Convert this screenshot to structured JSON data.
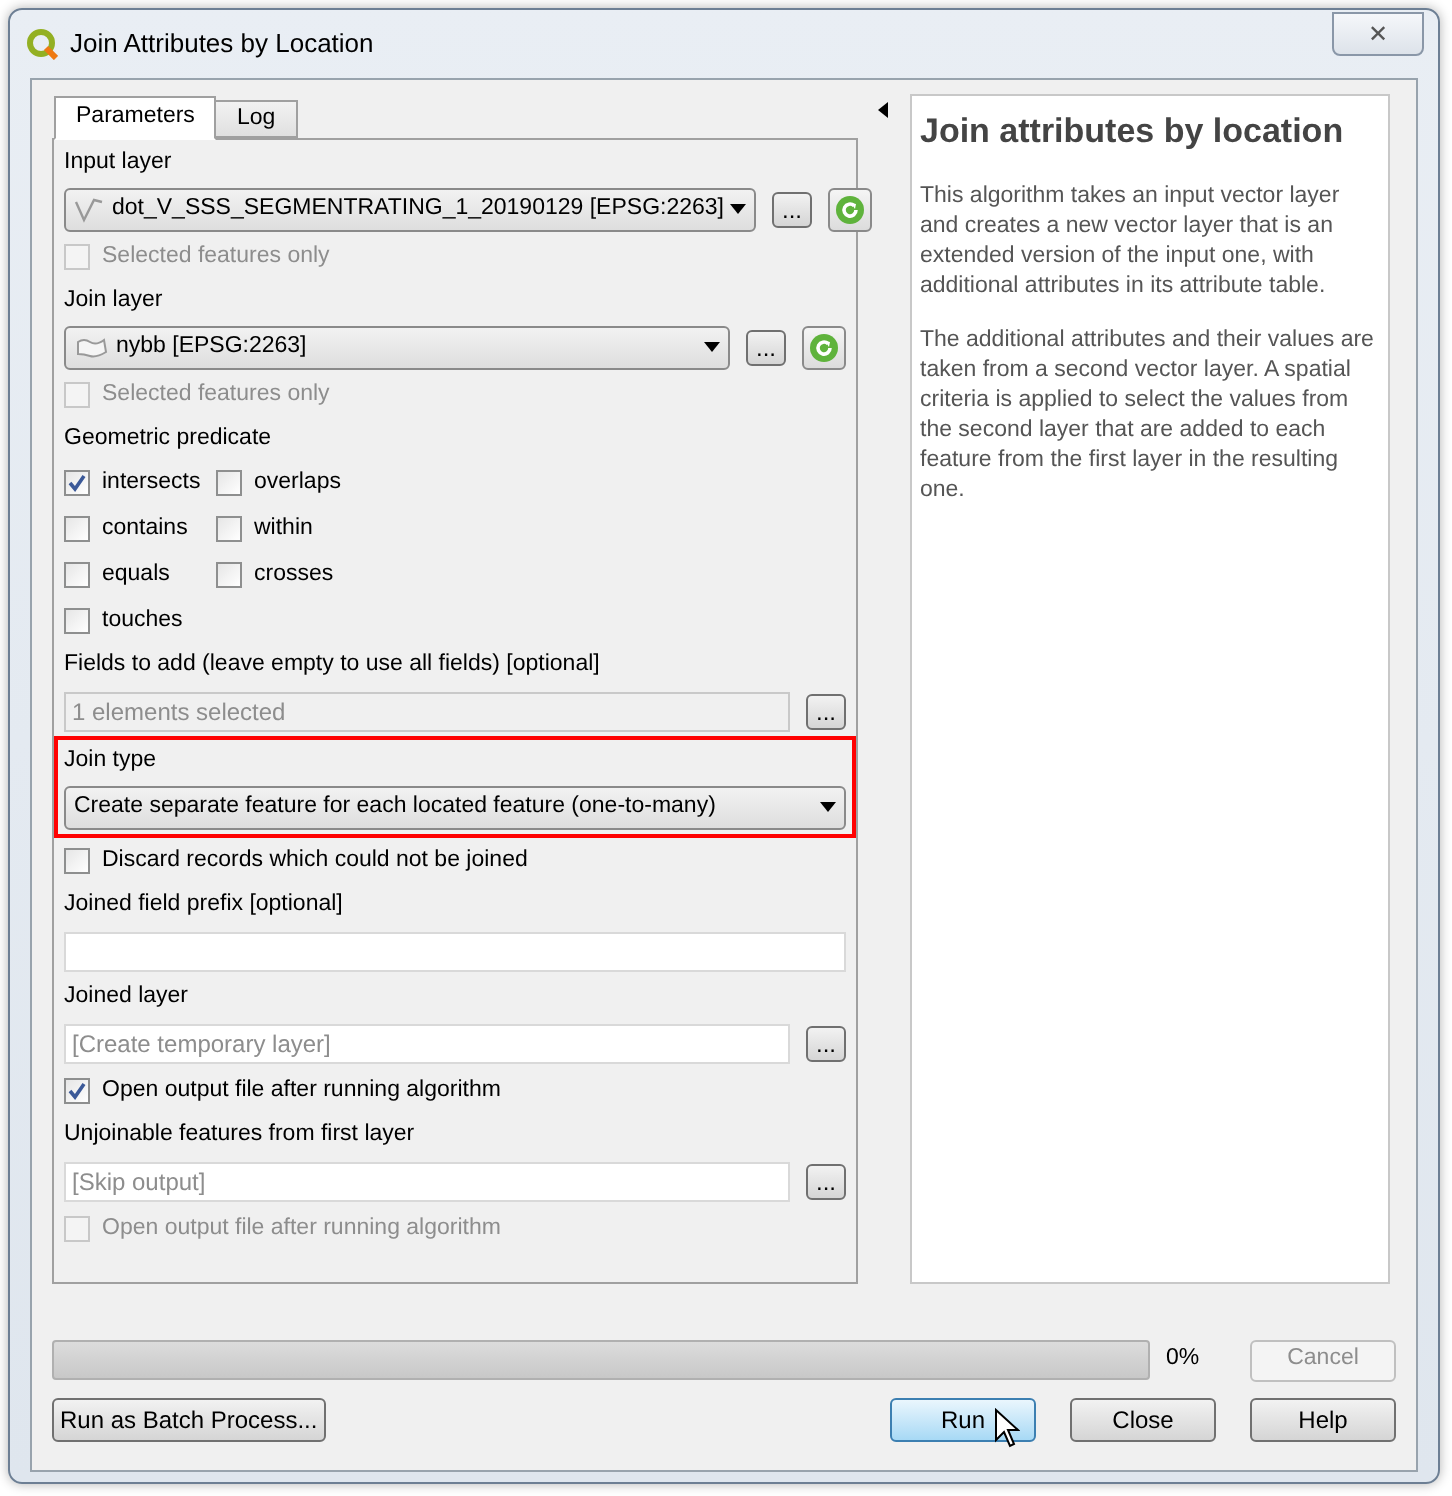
{
  "window": {
    "title": "Join Attributes by Location",
    "close_label": "✕"
  },
  "tabs": [
    {
      "label": "Parameters",
      "selected": true
    },
    {
      "label": "Log",
      "selected": false
    }
  ],
  "params": [
    {
      "kind": "label",
      "text": "Input layer"
    },
    {
      "kind": "line_layer_combo",
      "value": "dot_V_SSS_SEGMENTRATING_1_20190129 [EPSG:2263]",
      "browse_label": "..."
    },
    {
      "kind": "checkbox",
      "label": "Selected features only",
      "checked": false,
      "disabled": true
    },
    {
      "kind": "label",
      "text": "Join layer"
    },
    {
      "kind": "polygon_layer_combo",
      "value": "nybb [EPSG:2263]",
      "browse_label": "..."
    },
    {
      "kind": "checkbox",
      "label": "Selected features only",
      "checked": false,
      "disabled": true
    },
    {
      "kind": "label",
      "text": "Geometric predicate"
    },
    {
      "kind": "checkbox_grid",
      "items": [
        {
          "label": "intersects",
          "checked": true
        },
        {
          "label": "overlaps",
          "checked": false
        },
        {
          "label": "contains",
          "checked": false
        },
        {
          "label": "within",
          "checked": false
        },
        {
          "label": "equals",
          "checked": false
        },
        {
          "label": "crosses",
          "checked": false
        },
        {
          "label": "touches",
          "checked": false
        }
      ]
    },
    {
      "kind": "label",
      "text": "Fields to add (leave empty to use all fields) [optional]"
    },
    {
      "kind": "field",
      "value": "1 elements selected",
      "disabled": true,
      "browse_label": "..."
    },
    {
      "kind": "group",
      "highlighted": true,
      "children": [
        {
          "kind": "label",
          "text": "Join type"
        },
        {
          "kind": "combo",
          "value": "Create separate feature for each located feature (one-to-many)"
        }
      ]
    },
    {
      "kind": "checkbox",
      "label": "Discard records which could not be joined",
      "checked": false,
      "disabled": false
    },
    {
      "kind": "label",
      "text": "Joined field prefix [optional]"
    },
    {
      "kind": "field",
      "disabled": false
    },
    {
      "kind": "label",
      "text": "Joined layer"
    },
    {
      "kind": "field",
      "placeholder": "[Create temporary layer]",
      "disabled": false,
      "browse_label": "..."
    },
    {
      "kind": "checkbox",
      "label": "Open output file after running algorithm",
      "checked": true,
      "disabled": false
    },
    {
      "kind": "label",
      "text": "Unjoinable features from first layer"
    },
    {
      "kind": "field",
      "placeholder": "[Skip output]",
      "disabled": false,
      "browse_label": "..."
    },
    {
      "kind": "checkbox",
      "label": "Open output file after running algorithm",
      "checked": false,
      "disabled": true
    }
  ],
  "help": {
    "title": "Join attributes by location",
    "paragraphs": [
      "This algorithm takes an input vector layer and creates a new vector layer that is an extended version of the input one, with additional attributes in its attribute table.",
      "The additional attributes and their values are taken from a second vector layer. A spatial criteria is applied to select the values from the second layer that are added to each feature from the first layer in the resulting one."
    ]
  },
  "progress": {
    "level": 0,
    "reading": "0%"
  },
  "cancel": {
    "label": "Cancel",
    "disabled": true
  },
  "buttons": [
    {
      "label": "Run as Batch Process...",
      "default": false
    },
    {
      "label": "Run",
      "default": true
    },
    {
      "label": "Close",
      "default": false
    },
    {
      "label": "Help",
      "default": false
    }
  ]
}
